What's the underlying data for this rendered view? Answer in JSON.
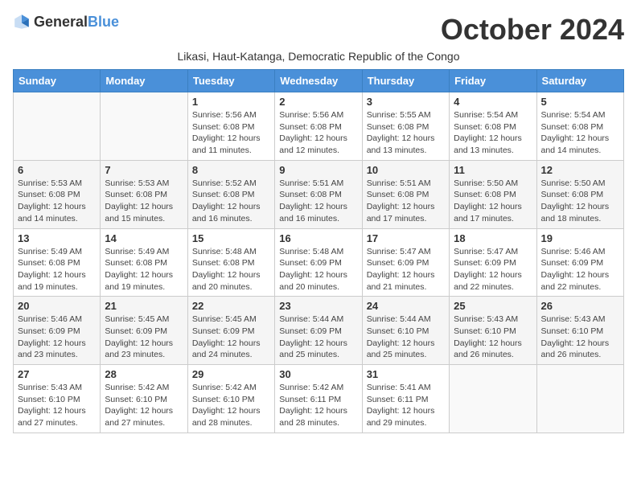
{
  "header": {
    "logo_general": "General",
    "logo_blue": "Blue",
    "month_title": "October 2024",
    "subtitle": "Likasi, Haut-Katanga, Democratic Republic of the Congo"
  },
  "weekdays": [
    "Sunday",
    "Monday",
    "Tuesday",
    "Wednesday",
    "Thursday",
    "Friday",
    "Saturday"
  ],
  "weeks": [
    [
      {
        "day": "",
        "info": ""
      },
      {
        "day": "",
        "info": ""
      },
      {
        "day": "1",
        "info": "Sunrise: 5:56 AM\nSunset: 6:08 PM\nDaylight: 12 hours and 11 minutes."
      },
      {
        "day": "2",
        "info": "Sunrise: 5:56 AM\nSunset: 6:08 PM\nDaylight: 12 hours and 12 minutes."
      },
      {
        "day": "3",
        "info": "Sunrise: 5:55 AM\nSunset: 6:08 PM\nDaylight: 12 hours and 13 minutes."
      },
      {
        "day": "4",
        "info": "Sunrise: 5:54 AM\nSunset: 6:08 PM\nDaylight: 12 hours and 13 minutes."
      },
      {
        "day": "5",
        "info": "Sunrise: 5:54 AM\nSunset: 6:08 PM\nDaylight: 12 hours and 14 minutes."
      }
    ],
    [
      {
        "day": "6",
        "info": "Sunrise: 5:53 AM\nSunset: 6:08 PM\nDaylight: 12 hours and 14 minutes."
      },
      {
        "day": "7",
        "info": "Sunrise: 5:53 AM\nSunset: 6:08 PM\nDaylight: 12 hours and 15 minutes."
      },
      {
        "day": "8",
        "info": "Sunrise: 5:52 AM\nSunset: 6:08 PM\nDaylight: 12 hours and 16 minutes."
      },
      {
        "day": "9",
        "info": "Sunrise: 5:51 AM\nSunset: 6:08 PM\nDaylight: 12 hours and 16 minutes."
      },
      {
        "day": "10",
        "info": "Sunrise: 5:51 AM\nSunset: 6:08 PM\nDaylight: 12 hours and 17 minutes."
      },
      {
        "day": "11",
        "info": "Sunrise: 5:50 AM\nSunset: 6:08 PM\nDaylight: 12 hours and 17 minutes."
      },
      {
        "day": "12",
        "info": "Sunrise: 5:50 AM\nSunset: 6:08 PM\nDaylight: 12 hours and 18 minutes."
      }
    ],
    [
      {
        "day": "13",
        "info": "Sunrise: 5:49 AM\nSunset: 6:08 PM\nDaylight: 12 hours and 19 minutes."
      },
      {
        "day": "14",
        "info": "Sunrise: 5:49 AM\nSunset: 6:08 PM\nDaylight: 12 hours and 19 minutes."
      },
      {
        "day": "15",
        "info": "Sunrise: 5:48 AM\nSunset: 6:08 PM\nDaylight: 12 hours and 20 minutes."
      },
      {
        "day": "16",
        "info": "Sunrise: 5:48 AM\nSunset: 6:09 PM\nDaylight: 12 hours and 20 minutes."
      },
      {
        "day": "17",
        "info": "Sunrise: 5:47 AM\nSunset: 6:09 PM\nDaylight: 12 hours and 21 minutes."
      },
      {
        "day": "18",
        "info": "Sunrise: 5:47 AM\nSunset: 6:09 PM\nDaylight: 12 hours and 22 minutes."
      },
      {
        "day": "19",
        "info": "Sunrise: 5:46 AM\nSunset: 6:09 PM\nDaylight: 12 hours and 22 minutes."
      }
    ],
    [
      {
        "day": "20",
        "info": "Sunrise: 5:46 AM\nSunset: 6:09 PM\nDaylight: 12 hours and 23 minutes."
      },
      {
        "day": "21",
        "info": "Sunrise: 5:45 AM\nSunset: 6:09 PM\nDaylight: 12 hours and 23 minutes."
      },
      {
        "day": "22",
        "info": "Sunrise: 5:45 AM\nSunset: 6:09 PM\nDaylight: 12 hours and 24 minutes."
      },
      {
        "day": "23",
        "info": "Sunrise: 5:44 AM\nSunset: 6:09 PM\nDaylight: 12 hours and 25 minutes."
      },
      {
        "day": "24",
        "info": "Sunrise: 5:44 AM\nSunset: 6:10 PM\nDaylight: 12 hours and 25 minutes."
      },
      {
        "day": "25",
        "info": "Sunrise: 5:43 AM\nSunset: 6:10 PM\nDaylight: 12 hours and 26 minutes."
      },
      {
        "day": "26",
        "info": "Sunrise: 5:43 AM\nSunset: 6:10 PM\nDaylight: 12 hours and 26 minutes."
      }
    ],
    [
      {
        "day": "27",
        "info": "Sunrise: 5:43 AM\nSunset: 6:10 PM\nDaylight: 12 hours and 27 minutes."
      },
      {
        "day": "28",
        "info": "Sunrise: 5:42 AM\nSunset: 6:10 PM\nDaylight: 12 hours and 27 minutes."
      },
      {
        "day": "29",
        "info": "Sunrise: 5:42 AM\nSunset: 6:10 PM\nDaylight: 12 hours and 28 minutes."
      },
      {
        "day": "30",
        "info": "Sunrise: 5:42 AM\nSunset: 6:11 PM\nDaylight: 12 hours and 28 minutes."
      },
      {
        "day": "31",
        "info": "Sunrise: 5:41 AM\nSunset: 6:11 PM\nDaylight: 12 hours and 29 minutes."
      },
      {
        "day": "",
        "info": ""
      },
      {
        "day": "",
        "info": ""
      }
    ]
  ]
}
